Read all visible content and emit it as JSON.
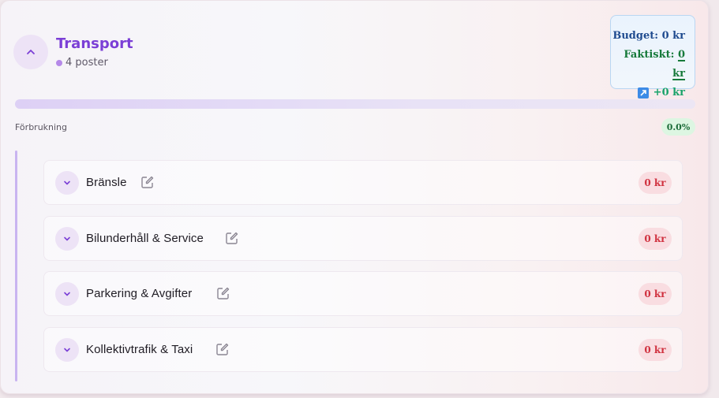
{
  "category": {
    "title": "Transport",
    "subtitle": "4 poster",
    "collapse_icon": "chevron-up-icon"
  },
  "summary": {
    "budget_label": "Budget:",
    "budget_value": "0 kr",
    "actual_label": "Faktiskt:",
    "actual_value": "0 kr",
    "diff_value": "+0 kr",
    "diff_icon": "trend-up-icon"
  },
  "usage": {
    "label": "Förbrukning",
    "percent_text": "0.0%",
    "percent_value": 0.0
  },
  "items": [
    {
      "label": "Bränsle",
      "amount": "0 kr"
    },
    {
      "label": "Bilunderhåll & Service",
      "amount": "0 kr"
    },
    {
      "label": "Parkering & Avgifter",
      "amount": "0 kr"
    },
    {
      "label": "Kollektivtrafik & Taxi",
      "amount": "0 kr"
    }
  ],
  "colors": {
    "accent": "#7b3fd6",
    "negative": "#d0313f",
    "positive": "#1e6d3a"
  }
}
